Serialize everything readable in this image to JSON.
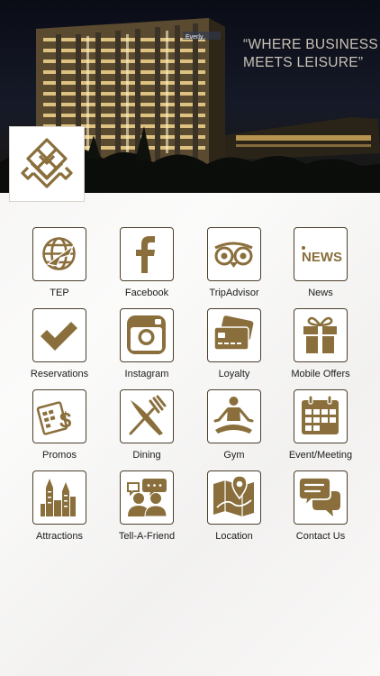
{
  "hero": {
    "tagline_line1": "“WHERE BUSINESS",
    "tagline_line2": "MEETS LEISURE”",
    "building_sign": "Everly"
  },
  "colors": {
    "icon_gold": "#8a6f3c",
    "icon_border": "#4c3f2c",
    "label_text": "#1c1c1c"
  },
  "menu": [
    {
      "label": "TEP",
      "icon": "globe-plane-icon"
    },
    {
      "label": "Facebook",
      "icon": "facebook-icon"
    },
    {
      "label": "TripAdvisor",
      "icon": "tripadvisor-owl-icon"
    },
    {
      "label": "News",
      "icon": "news-icon",
      "icon_text": "NEWS"
    },
    {
      "label": "Reservations",
      "icon": "checkmark-icon"
    },
    {
      "label": "Instagram",
      "icon": "instagram-icon"
    },
    {
      "label": "Loyalty",
      "icon": "loyalty-cards-icon"
    },
    {
      "label": "Mobile Offers",
      "icon": "gift-icon"
    },
    {
      "label": "Promos",
      "icon": "promos-dollar-icon"
    },
    {
      "label": "Dining",
      "icon": "fork-knife-icon"
    },
    {
      "label": "Gym",
      "icon": "meditation-icon"
    },
    {
      "label": "Event/Meeting",
      "icon": "calendar-icon"
    },
    {
      "label": "Attractions",
      "icon": "skyscraper-icon"
    },
    {
      "label": "Tell-A-Friend",
      "icon": "tell-friend-icon"
    },
    {
      "label": "Location",
      "icon": "map-pin-icon"
    },
    {
      "label": "Contact Us",
      "icon": "chat-bubbles-icon"
    }
  ]
}
